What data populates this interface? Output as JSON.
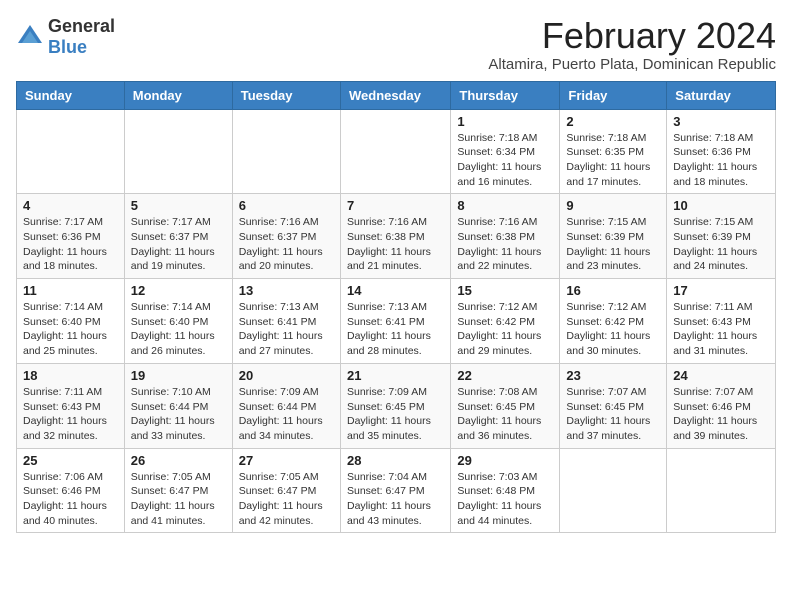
{
  "logo": {
    "general": "General",
    "blue": "Blue"
  },
  "header": {
    "month_year": "February 2024",
    "subtitle": "Altamira, Puerto Plata, Dominican Republic"
  },
  "weekdays": [
    "Sunday",
    "Monday",
    "Tuesday",
    "Wednesday",
    "Thursday",
    "Friday",
    "Saturday"
  ],
  "weeks": [
    [
      {
        "day": "",
        "info": ""
      },
      {
        "day": "",
        "info": ""
      },
      {
        "day": "",
        "info": ""
      },
      {
        "day": "",
        "info": ""
      },
      {
        "day": "1",
        "info": "Sunrise: 7:18 AM\nSunset: 6:34 PM\nDaylight: 11 hours and 16 minutes."
      },
      {
        "day": "2",
        "info": "Sunrise: 7:18 AM\nSunset: 6:35 PM\nDaylight: 11 hours and 17 minutes."
      },
      {
        "day": "3",
        "info": "Sunrise: 7:18 AM\nSunset: 6:36 PM\nDaylight: 11 hours and 18 minutes."
      }
    ],
    [
      {
        "day": "4",
        "info": "Sunrise: 7:17 AM\nSunset: 6:36 PM\nDaylight: 11 hours and 18 minutes."
      },
      {
        "day": "5",
        "info": "Sunrise: 7:17 AM\nSunset: 6:37 PM\nDaylight: 11 hours and 19 minutes."
      },
      {
        "day": "6",
        "info": "Sunrise: 7:16 AM\nSunset: 6:37 PM\nDaylight: 11 hours and 20 minutes."
      },
      {
        "day": "7",
        "info": "Sunrise: 7:16 AM\nSunset: 6:38 PM\nDaylight: 11 hours and 21 minutes."
      },
      {
        "day": "8",
        "info": "Sunrise: 7:16 AM\nSunset: 6:38 PM\nDaylight: 11 hours and 22 minutes."
      },
      {
        "day": "9",
        "info": "Sunrise: 7:15 AM\nSunset: 6:39 PM\nDaylight: 11 hours and 23 minutes."
      },
      {
        "day": "10",
        "info": "Sunrise: 7:15 AM\nSunset: 6:39 PM\nDaylight: 11 hours and 24 minutes."
      }
    ],
    [
      {
        "day": "11",
        "info": "Sunrise: 7:14 AM\nSunset: 6:40 PM\nDaylight: 11 hours and 25 minutes."
      },
      {
        "day": "12",
        "info": "Sunrise: 7:14 AM\nSunset: 6:40 PM\nDaylight: 11 hours and 26 minutes."
      },
      {
        "day": "13",
        "info": "Sunrise: 7:13 AM\nSunset: 6:41 PM\nDaylight: 11 hours and 27 minutes."
      },
      {
        "day": "14",
        "info": "Sunrise: 7:13 AM\nSunset: 6:41 PM\nDaylight: 11 hours and 28 minutes."
      },
      {
        "day": "15",
        "info": "Sunrise: 7:12 AM\nSunset: 6:42 PM\nDaylight: 11 hours and 29 minutes."
      },
      {
        "day": "16",
        "info": "Sunrise: 7:12 AM\nSunset: 6:42 PM\nDaylight: 11 hours and 30 minutes."
      },
      {
        "day": "17",
        "info": "Sunrise: 7:11 AM\nSunset: 6:43 PM\nDaylight: 11 hours and 31 minutes."
      }
    ],
    [
      {
        "day": "18",
        "info": "Sunrise: 7:11 AM\nSunset: 6:43 PM\nDaylight: 11 hours and 32 minutes."
      },
      {
        "day": "19",
        "info": "Sunrise: 7:10 AM\nSunset: 6:44 PM\nDaylight: 11 hours and 33 minutes."
      },
      {
        "day": "20",
        "info": "Sunrise: 7:09 AM\nSunset: 6:44 PM\nDaylight: 11 hours and 34 minutes."
      },
      {
        "day": "21",
        "info": "Sunrise: 7:09 AM\nSunset: 6:45 PM\nDaylight: 11 hours and 35 minutes."
      },
      {
        "day": "22",
        "info": "Sunrise: 7:08 AM\nSunset: 6:45 PM\nDaylight: 11 hours and 36 minutes."
      },
      {
        "day": "23",
        "info": "Sunrise: 7:07 AM\nSunset: 6:45 PM\nDaylight: 11 hours and 37 minutes."
      },
      {
        "day": "24",
        "info": "Sunrise: 7:07 AM\nSunset: 6:46 PM\nDaylight: 11 hours and 39 minutes."
      }
    ],
    [
      {
        "day": "25",
        "info": "Sunrise: 7:06 AM\nSunset: 6:46 PM\nDaylight: 11 hours and 40 minutes."
      },
      {
        "day": "26",
        "info": "Sunrise: 7:05 AM\nSunset: 6:47 PM\nDaylight: 11 hours and 41 minutes."
      },
      {
        "day": "27",
        "info": "Sunrise: 7:05 AM\nSunset: 6:47 PM\nDaylight: 11 hours and 42 minutes."
      },
      {
        "day": "28",
        "info": "Sunrise: 7:04 AM\nSunset: 6:47 PM\nDaylight: 11 hours and 43 minutes."
      },
      {
        "day": "29",
        "info": "Sunrise: 7:03 AM\nSunset: 6:48 PM\nDaylight: 11 hours and 44 minutes."
      },
      {
        "day": "",
        "info": ""
      },
      {
        "day": "",
        "info": ""
      }
    ]
  ]
}
